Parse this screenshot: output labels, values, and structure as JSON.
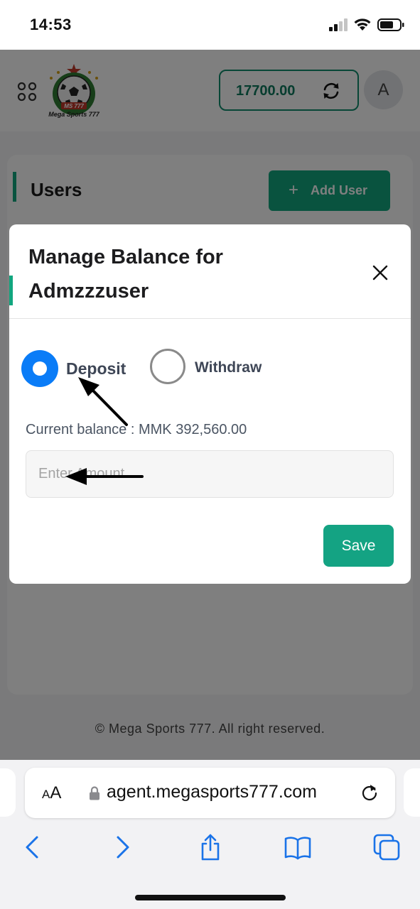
{
  "status_bar": {
    "time": "14:53"
  },
  "header": {
    "logo_text": "Mega Sports 777",
    "logo_badge": "MS 777",
    "balance": "17700.00",
    "avatar_initial": "A"
  },
  "users": {
    "title": "Users",
    "add_user_label": "Add User"
  },
  "footer": {
    "copyright": "© Mega Sports 777. All right reserved."
  },
  "modal": {
    "title": "Manage Balance for Admzzzuser",
    "deposit_label": "Deposit",
    "withdraw_label": "Withdraw",
    "selected_option": "Deposit",
    "current_balance_text": "Current balance : MMK 392,560.00",
    "amount_placeholder": "Enter Amount",
    "save_label": "Save"
  },
  "browser": {
    "aa_label_small": "A",
    "aa_label_large": "A",
    "url": "agent.megasports777.com"
  },
  "colors": {
    "accent": "#12a67f",
    "radio_selected": "#0a7cf7",
    "overlay": "rgba(0,0,0,0.5)"
  },
  "icons": [
    "apps-icon",
    "refresh-icon",
    "plus-icon",
    "close-icon",
    "lock-icon",
    "reload-icon",
    "back-icon",
    "forward-icon",
    "share-icon",
    "bookmarks-icon",
    "tabs-icon",
    "signal-icon",
    "wifi-icon",
    "battery-icon"
  ]
}
